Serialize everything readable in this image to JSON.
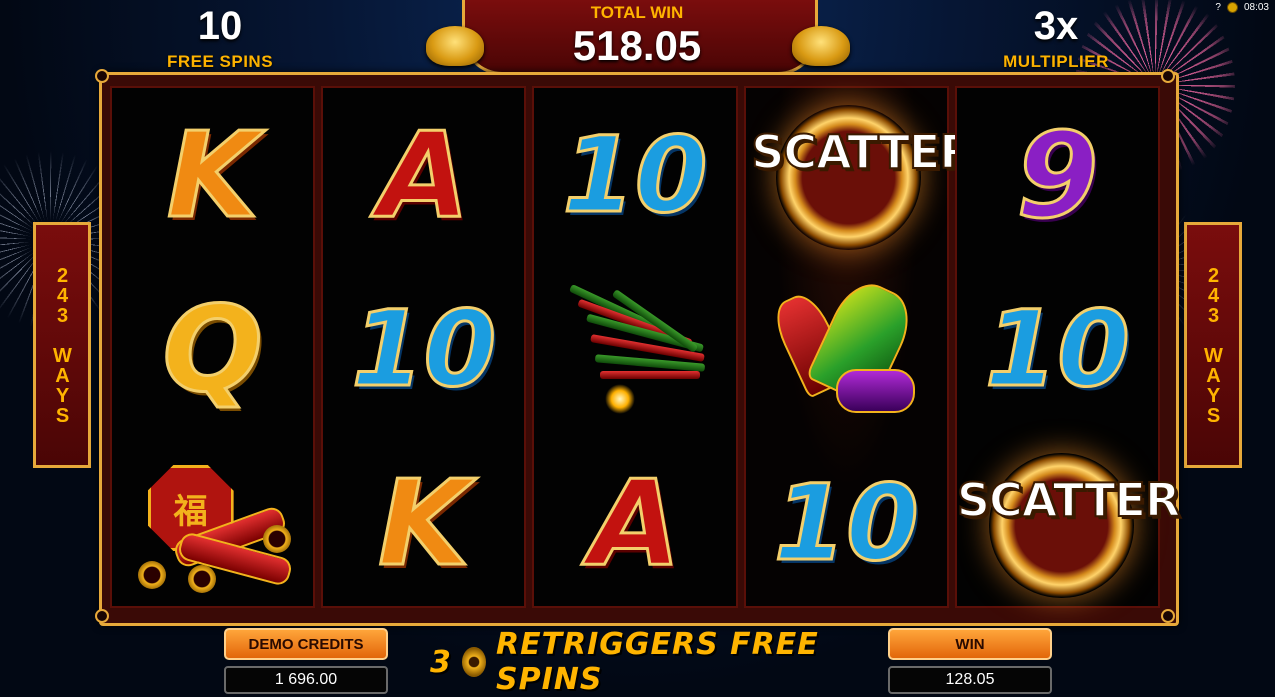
{
  "status_bar": {
    "help": "?",
    "time": "08:03"
  },
  "hud": {
    "free_spins_count": "10",
    "free_spins_label": "FREE SPINS",
    "total_win_label": "TOTAL WIN",
    "total_win_value": "518.05",
    "multiplier_value": "3x",
    "multiplier_label": "MULTIPLIER"
  },
  "ways_left": "243 WAYS",
  "ways_right": "243 WAYS",
  "reels": [
    [
      "K",
      "Q",
      "LANTERN"
    ],
    [
      "A",
      "10",
      "K"
    ],
    [
      "10",
      "FIRECRACKERS",
      "A"
    ],
    [
      "SCATTER",
      "ROCKETS",
      "10"
    ],
    [
      "9",
      "10",
      "SCATTER"
    ]
  ],
  "scatter_text": "SCATTER",
  "lantern_glyph": "福",
  "bottom": {
    "credits_label": "DEMO CREDITS",
    "credits_value": "1 696.00",
    "message_count": "3",
    "message_text": "RETRIGGERS FREE SPINS",
    "win_label": "WIN",
    "win_value": "128.05"
  },
  "colors": {
    "gold": "#ffb400",
    "frame": "#e7a93a",
    "banner_red": "#7a0d0d",
    "button_orange": "#f07c1a"
  }
}
